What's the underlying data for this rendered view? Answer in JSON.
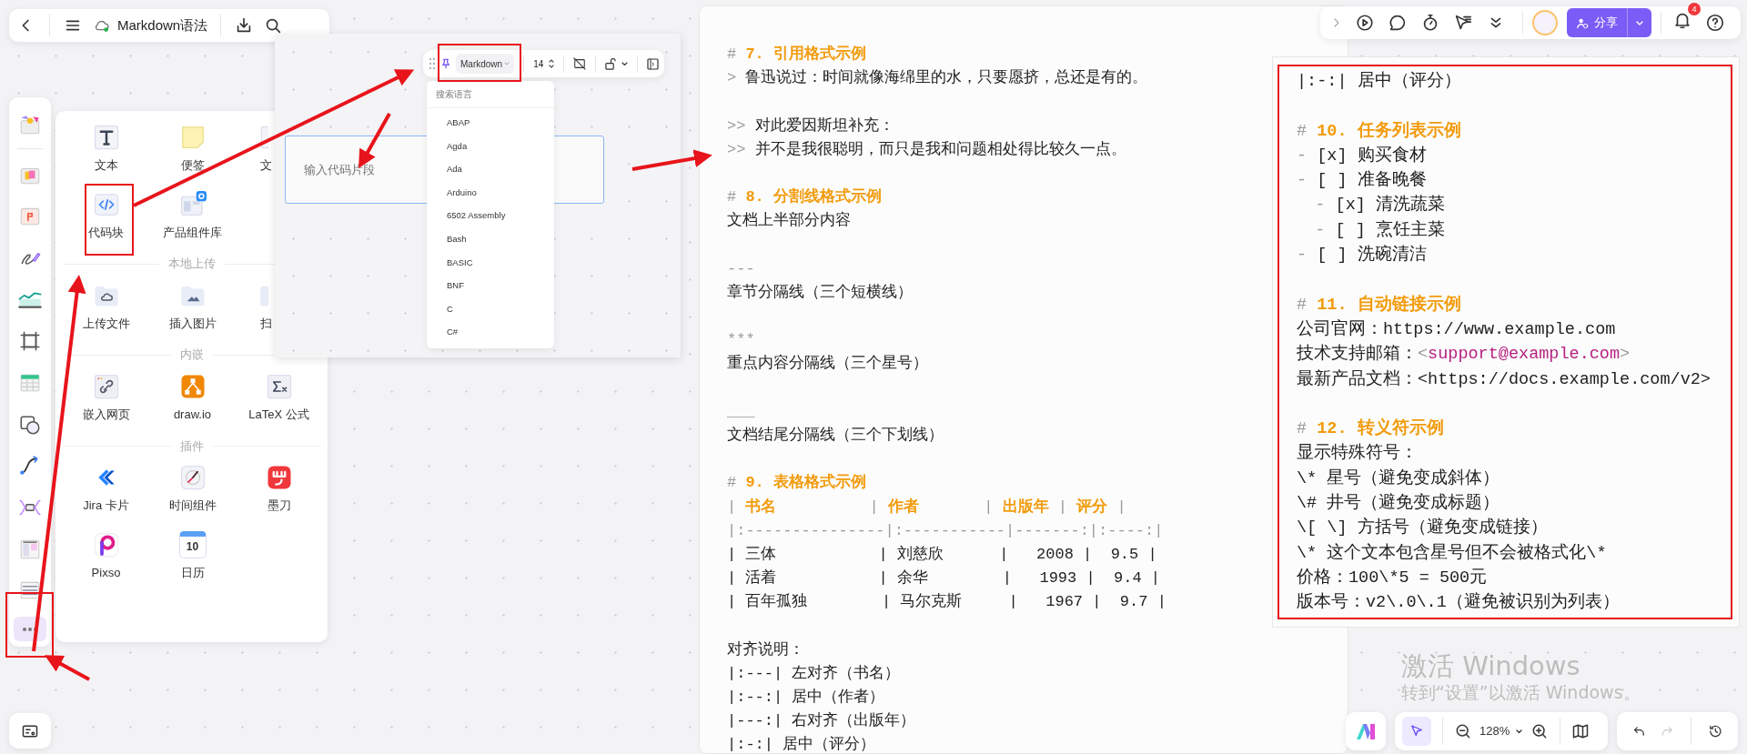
{
  "top_bar": {
    "title": "Markdown语法",
    "synced": true
  },
  "tool_rail": {
    "more_selected": true
  },
  "insert_panel": {
    "groups": [
      {
        "items": [
          {
            "kind": "text",
            "label": "文本"
          },
          {
            "kind": "note",
            "label": "便签"
          },
          {
            "kind": "doc",
            "label": "文"
          },
          {
            "kind": "code",
            "label": "代码块"
          },
          {
            "kind": "component",
            "label": "产品组件库"
          }
        ]
      },
      {
        "heading": "本地上传",
        "items": [
          {
            "kind": "upload",
            "label": "上传文件"
          },
          {
            "kind": "image",
            "label": "插入图片"
          },
          {
            "kind": "scan",
            "label": "扫"
          }
        ]
      },
      {
        "heading": "内嵌",
        "items": [
          {
            "kind": "web",
            "label": "嵌入网页"
          },
          {
            "kind": "drawio",
            "label": "draw.io"
          },
          {
            "kind": "latex",
            "label": "LaTeX 公式"
          }
        ]
      },
      {
        "heading": "插件",
        "items": [
          {
            "kind": "jira",
            "label": "Jira 卡片"
          },
          {
            "kind": "clock",
            "label": "时间组件"
          },
          {
            "kind": "modao",
            "label": "墨刀"
          },
          {
            "kind": "pixso",
            "label": "Pixso"
          },
          {
            "kind": "calendar",
            "label": "日历",
            "icon_text": "10"
          }
        ]
      }
    ]
  },
  "code_popup": {
    "language": "Markdown",
    "font_size": "14",
    "language_menu": {
      "placeholder": "搜索语言",
      "items": [
        "ABAP",
        "Agda",
        "Ada",
        "Arduino",
        "6502 Assembly",
        "Bash",
        "BASIC",
        "BNF",
        "C",
        "C#"
      ]
    },
    "code_field": {
      "placeholder": "输入代码片段"
    }
  },
  "doc_main": {
    "lines": [
      {
        "kind": "heading",
        "marker": "#",
        "text": "7. 引用格式示例"
      },
      {
        "kind": "quote",
        "marker": ">",
        "text": "鲁迅说过：时间就像海绵里的水，只要愿挤，总还是有的。"
      },
      {
        "kind": "blank"
      },
      {
        "kind": "quote",
        "marker": ">>",
        "text": "对此爱因斯坦补充："
      },
      {
        "kind": "quote",
        "marker": ">>",
        "text": "并不是我很聪明，而只是我和问题相处得比较久一点。"
      },
      {
        "kind": "blank"
      },
      {
        "kind": "heading",
        "marker": "#",
        "text": "8. 分割线格式示例"
      },
      {
        "kind": "text",
        "text": "文档上半部分内容"
      },
      {
        "kind": "blank"
      },
      {
        "kind": "rule",
        "text": "---"
      },
      {
        "kind": "text",
        "text": "章节分隔线（三个短横线）"
      },
      {
        "kind": "blank"
      },
      {
        "kind": "rule",
        "text": "***"
      },
      {
        "kind": "text",
        "text": "重点内容分隔线（三个星号）"
      },
      {
        "kind": "blank"
      },
      {
        "kind": "rule",
        "text": "___"
      },
      {
        "kind": "text",
        "text": "文档结尾分隔线（三个下划线）"
      },
      {
        "kind": "blank"
      },
      {
        "kind": "heading",
        "marker": "#",
        "text": "9. 表格格式示例"
      },
      {
        "kind": "table_header",
        "text": "| **书名**          | **作者**       | **出版年** | **评分** |"
      },
      {
        "kind": "table_sep",
        "text": "|:---------------|:-----------|-------:|:----:|"
      },
      {
        "kind": "table_row",
        "text": "| 三体           | 刘慈欣      |   2008 |  9.5 |"
      },
      {
        "kind": "table_row",
        "text": "| 活着           | 余华        |   1993 |  9.4 |"
      },
      {
        "kind": "table_row",
        "text": "| 百年孤独        | 马尔克斯     |   1967 |  9.7 |"
      },
      {
        "kind": "blank"
      },
      {
        "kind": "text",
        "text": "对齐说明："
      },
      {
        "kind": "text",
        "text": "|:---| 左对齐（书名）"
      },
      {
        "kind": "text",
        "text": "|:--:| 居中（作者）"
      },
      {
        "kind": "text",
        "text": "|---:| 右对齐（出版年）"
      },
      {
        "kind": "text",
        "text": "|:-:| 居中（评分）"
      }
    ]
  },
  "doc_side": {
    "lines": [
      {
        "kind": "text",
        "text": "|:-:| 居中（评分）"
      },
      {
        "kind": "blank"
      },
      {
        "kind": "heading",
        "marker": "#",
        "text": "10. 任务列表示例"
      },
      {
        "kind": "task",
        "marker": "-",
        "box": "[x]",
        "text": "购买食材"
      },
      {
        "kind": "task",
        "marker": "-",
        "box": "[ ]",
        "text": "准备晚餐",
        "children": [
          {
            "kind": "task",
            "marker": "-",
            "box": "[x]",
            "text": "清洗蔬菜"
          },
          {
            "kind": "task",
            "marker": "-",
            "box": "[ ]",
            "text": "烹饪主菜"
          }
        ]
      },
      {
        "kind": "task",
        "marker": "-",
        "box": "[ ]",
        "text": "洗碗清洁"
      },
      {
        "kind": "blank"
      },
      {
        "kind": "heading",
        "marker": "#",
        "text": "11. 自动链接示例"
      },
      {
        "kind": "text",
        "text": "公司官网：https://www.example.com"
      },
      {
        "kind": "link_line",
        "label": "技术支持邮箱：",
        "pre": "<",
        "link": "support@example.com",
        "post": ">"
      },
      {
        "kind": "text",
        "text": "最新产品文档：<https://docs.example.com/v2>"
      },
      {
        "kind": "blank"
      },
      {
        "kind": "heading",
        "marker": "#",
        "text": "12. 转义符示例"
      },
      {
        "kind": "text",
        "text": "显示特殊符号："
      },
      {
        "kind": "text",
        "text": "\\* 星号（避免变成斜体）"
      },
      {
        "kind": "text",
        "text": "\\# 井号（避免变成标题）"
      },
      {
        "kind": "text",
        "text": "\\[ \\] 方括号（避免变成链接）"
      },
      {
        "kind": "text",
        "text": "\\* 这个文本包含星号但不会被格式化\\*"
      },
      {
        "kind": "text",
        "text": "价格：100\\*5 = 500元"
      },
      {
        "kind": "text",
        "text": "版本号：v2\\.0\\.1（避免被识别为列表）"
      }
    ]
  },
  "top_right": {
    "share": "分享",
    "notifications": "4"
  },
  "bottom_bar": {
    "zoom": "128%",
    "pointer_selected": true,
    "redo_disabled": true
  },
  "os_notice": {
    "title": "激活 Windows",
    "subtitle": "转到“设置”以激活 Windows。"
  }
}
